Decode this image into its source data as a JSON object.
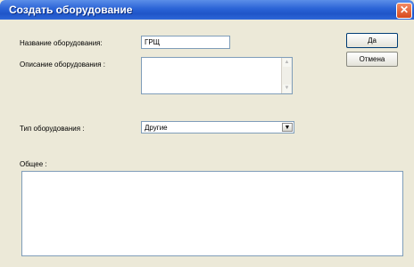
{
  "window": {
    "title": "Создать оборудование",
    "close_glyph": "✕"
  },
  "form": {
    "name_label": "Название оборудования:",
    "name_value": "ГРЩ",
    "description_label": "Описание оборудования :",
    "description_value": "",
    "type_label": "Тип оборудования :",
    "type_value": "Другие",
    "general_label": "Общее :",
    "general_value": ""
  },
  "buttons": {
    "ok_label": "Да",
    "cancel_label": "Отмена"
  },
  "icons": {
    "scroll_up": "▲",
    "scroll_down": "▼",
    "dropdown": "▼"
  },
  "colors": {
    "titlebar": "#2a63d6",
    "close": "#d8491c",
    "dialog_bg": "#ece9d8"
  }
}
